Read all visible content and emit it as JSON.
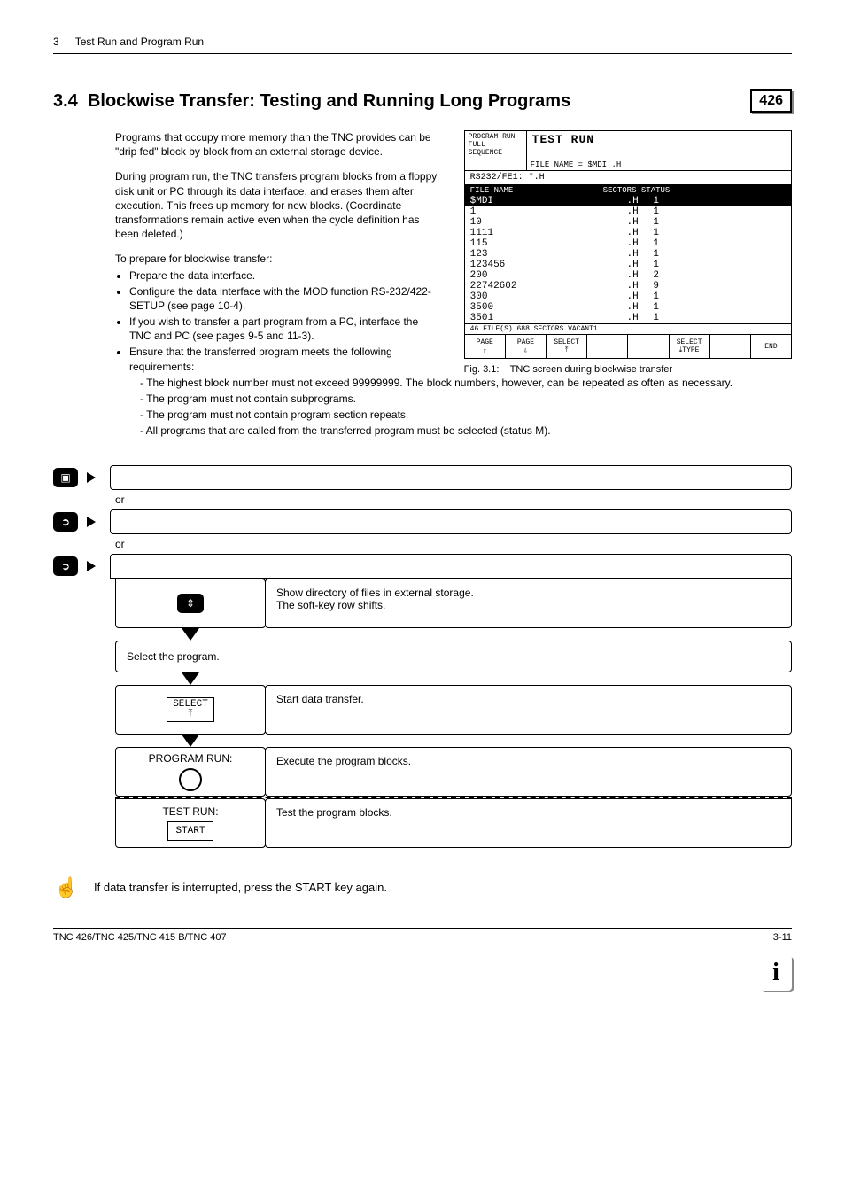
{
  "header": {
    "page_top_num": "3",
    "chapter": "Test Run and Program Run"
  },
  "section": {
    "number": "3.4",
    "title": "Blockwise Transfer: Testing and Running Long Programs",
    "badge": "426"
  },
  "body": {
    "p1": "Programs that occupy more memory than the TNC provides can be \"drip fed\" block by block from an external storage device.",
    "p2": "During program run, the TNC transfers program blocks from a floppy disk unit or PC through its data interface, and erases them after execution. This frees up memory for new blocks. (Coordinate transformations remain active even when the cycle definition has been deleted.)",
    "prep_intro": "To prepare for blockwise transfer:",
    "bullets": [
      "Prepare the data interface.",
      "Configure the data interface with the MOD function RS-232/422-SETUP (see page 10-4).",
      "If you wish to transfer a part program from a PC, interface the TNC and PC (see pages 9-5 and 11-3).",
      "Ensure that the transferred program meets the following requirements:"
    ],
    "subreqs": [
      "The highest block number must not exceed 99999999. The block numbers, however, can be repeated as often as necessary.",
      "The program must not contain subprograms.",
      "The program must not contain program section repeats.",
      "All programs that are called from the transferred program must be selected (status M)."
    ]
  },
  "tnc": {
    "corner1": "PROGRAM RUN",
    "corner2": "FULL SEQUENCE",
    "title": "TEST RUN",
    "filebar": "FILE NAME = $MDI            .H",
    "subline": "RS232/FE1: *.H",
    "col_file": "FILE NAME",
    "col_sectors": "SECTORS",
    "col_status": "STATUS",
    "rows": [
      {
        "name": "$MDI",
        "ext": ".H",
        "s": "1"
      },
      {
        "name": "1",
        "ext": ".H",
        "s": "1"
      },
      {
        "name": "10",
        "ext": ".H",
        "s": "1"
      },
      {
        "name": "1111",
        "ext": ".H",
        "s": "1"
      },
      {
        "name": "115",
        "ext": ".H",
        "s": "1"
      },
      {
        "name": "123",
        "ext": ".H",
        "s": "1"
      },
      {
        "name": "123456",
        "ext": ".H",
        "s": "1"
      },
      {
        "name": "200",
        "ext": ".H",
        "s": "2"
      },
      {
        "name": "22742602",
        "ext": ".H",
        "s": "9"
      },
      {
        "name": "300",
        "ext": ".H",
        "s": "1"
      },
      {
        "name": "3500",
        "ext": ".H",
        "s": "1"
      },
      {
        "name": "3501",
        "ext": ".H",
        "s": "1"
      }
    ],
    "footer": "46 FILE(S) 688 SECTORS VACANT1",
    "softkeys": [
      "PAGE\n⇧",
      "PAGE\n⇩",
      "SELECT\n⤒",
      "",
      "",
      "SELECT\n⤓TYPE",
      "",
      "END"
    ],
    "caption_label": "Fig. 3.1:",
    "caption_text": "TNC screen during blockwise transfer"
  },
  "flow": {
    "or": "or",
    "show_dir": "Show directory of files in external storage.\nThe soft-key row shifts.",
    "select_prog": "Select the program.",
    "select_key": "SELECT",
    "start_transfer": "Start data transfer.",
    "prog_run": "PROGRAM RUN:",
    "exec_blocks": "Execute the program blocks.",
    "test_run": "TEST RUN:",
    "start_key": "START",
    "test_blocks": "Test the program blocks."
  },
  "note": "If data transfer is interrupted, press the START key again.",
  "footer": {
    "left": "TNC 426/TNC 425/TNC 415 B/TNC 407",
    "right": "3-11"
  }
}
